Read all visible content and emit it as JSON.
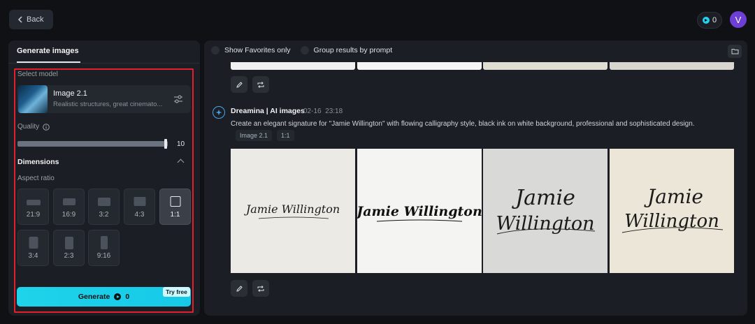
{
  "topbar": {
    "back_label": "Back",
    "credits": "0",
    "avatar_initial": "V"
  },
  "left_panel": {
    "tab": "Generate images",
    "select_model_label": "Select model",
    "model": {
      "name": "Image 2.1",
      "description": "Realistic structures, great cinemato..."
    },
    "quality": {
      "label": "Quality",
      "value": "10",
      "level": 10,
      "max": 10
    },
    "dimensions": {
      "title": "Dimensions",
      "aspect_ratio_label": "Aspect ratio",
      "ratios": [
        "21:9",
        "16:9",
        "3:2",
        "4:3",
        "1:1",
        "3:4",
        "2:3",
        "9:16"
      ],
      "selected": "1:1"
    },
    "generate": {
      "label": "Generate",
      "credits": "0",
      "badge": "Try free"
    }
  },
  "right_panel": {
    "filters": {
      "favorites": "Show Favorites only",
      "group": "Group results by prompt"
    },
    "result": {
      "author": "Dreamina | AI images",
      "date": "02-16",
      "time": "23:18",
      "prompt": "Create an elegant signature for \"Jamie Willington\" with flowing calligraphy style, black ink on white background, professional and sophisticated design.",
      "tags": [
        "Image 2.1",
        "1:1"
      ],
      "images": [
        {
          "text_line1": "Jamie Willington",
          "text_line2": ""
        },
        {
          "text_line1": "Jamie Willington",
          "text_line2": ""
        },
        {
          "text_line1": "Jamie",
          "text_line2": "Willington"
        },
        {
          "text_line1": "Jamie",
          "text_line2": "Willington"
        }
      ]
    }
  },
  "colors": {
    "accent": "#1fd3ea",
    "highlight_border": "#e0202d",
    "avatar": "#6d3fd4"
  }
}
